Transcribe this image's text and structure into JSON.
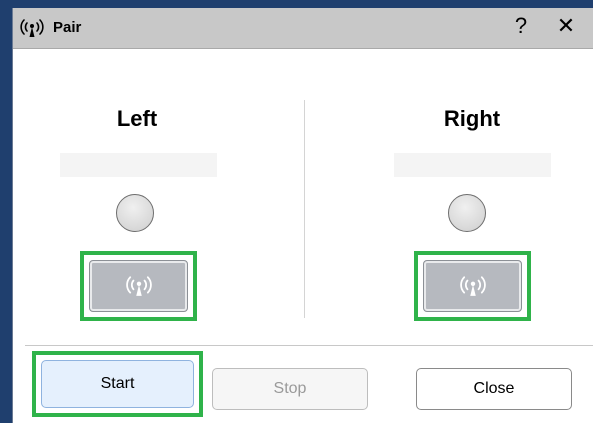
{
  "window": {
    "title": "Pair",
    "icon": "antenna-signal-icon",
    "help_label": "?",
    "close_label": "✕"
  },
  "left": {
    "heading": "Left",
    "device_name": "",
    "indicator_state": "off",
    "pair_icon": "antenna-signal-icon"
  },
  "right": {
    "heading": "Right",
    "device_name": "",
    "indicator_state": "off",
    "pair_icon": "antenna-signal-icon"
  },
  "footer": {
    "start_label": "Start",
    "stop_label": "Stop",
    "close_label": "Close"
  },
  "colors": {
    "highlight": "#2fb34a",
    "titlebar": "#c8c8c8",
    "pair_button": "#b6b9bf",
    "start_button": "#e5f0fd"
  }
}
